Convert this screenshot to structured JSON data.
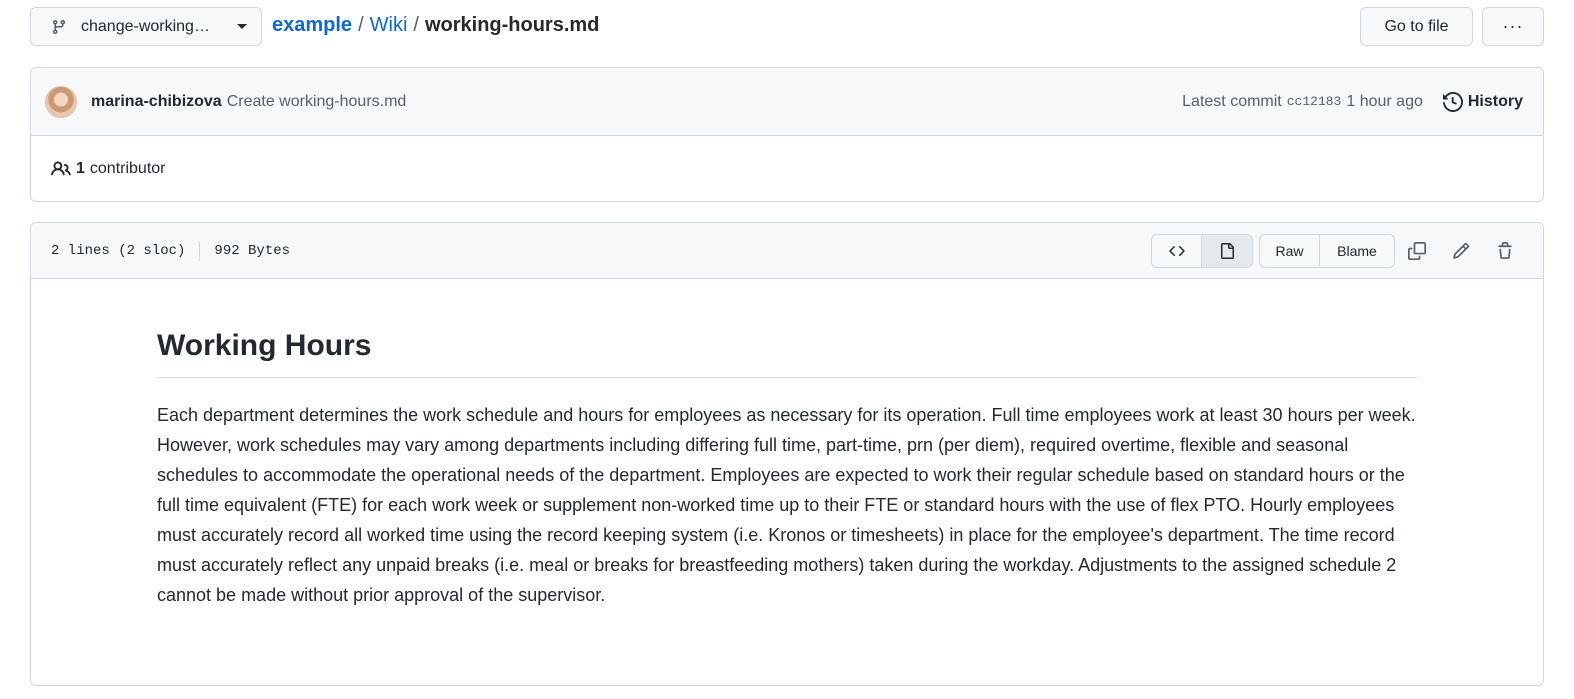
{
  "branch": {
    "label": "change-working…",
    "icon": "git-branch-icon"
  },
  "breadcrumb": {
    "repo": "example",
    "folder": "Wiki",
    "file": "working-hours.md",
    "separator": "/"
  },
  "header_buttons": {
    "goto": "Go to file",
    "more": "···"
  },
  "commit": {
    "author": "marina-chibizova",
    "message": "Create working-hours.md",
    "latest_label": "Latest commit",
    "sha": "cc12183",
    "time": "1 hour ago",
    "history_label": "History"
  },
  "contributors": {
    "count": "1",
    "label": "contributor"
  },
  "file": {
    "lines": "2 lines (2 sloc)",
    "size": "992 Bytes",
    "raw_label": "Raw",
    "blame_label": "Blame"
  },
  "markdown": {
    "title": "Working Hours",
    "paragraph": "Each department determines the work schedule and hours for employees as necessary for its operation. Full time employees work at least 30 hours per week. However, work schedules may vary among departments including differing full time, part-time, prn (per diem), required overtime, flexible and seasonal schedules to accommodate the operational needs of the department. Employees are expected to work their regular schedule based on standard hours or the full time equivalent (FTE) for each work week or supplement non-worked time up to their FTE or standard hours with the use of flex PTO. Hourly employees must accurately record all worked time using the record keeping system (i.e. Kronos or timesheets) in place for the employee's department. The time record must accurately reflect any unpaid breaks (i.e. meal or breaks for breastfeeding mothers) taken during the workday. Adjustments to the assigned schedule 2 cannot be made without prior approval of the supervisor."
  },
  "colors": {
    "link": "#0969da",
    "border": "#d0d7de",
    "header_bg": "#f6f8fa",
    "text": "#24292f",
    "muted": "#57606a"
  }
}
